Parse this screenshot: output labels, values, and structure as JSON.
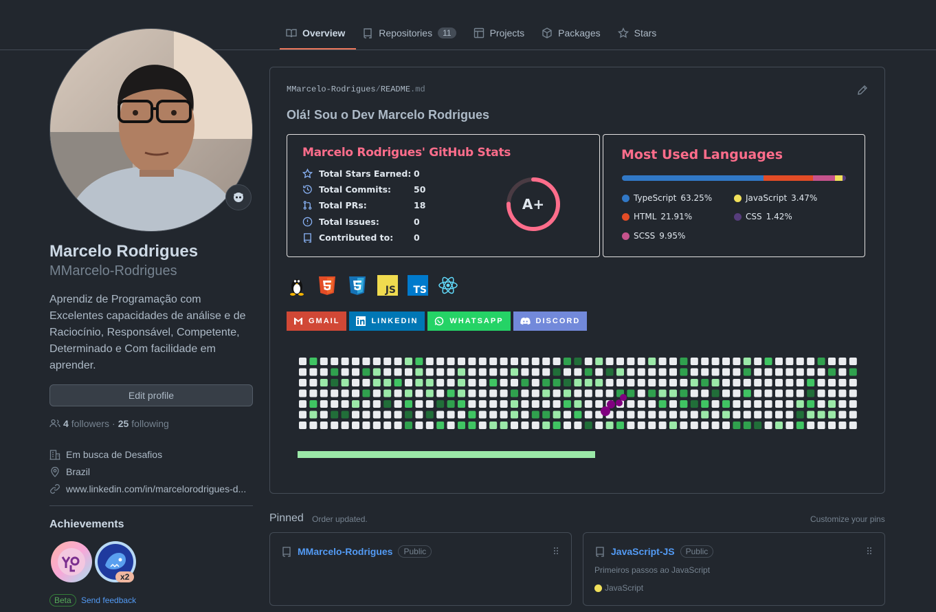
{
  "nav": {
    "tabs": [
      {
        "label": "Overview",
        "icon": "book-icon",
        "active": true
      },
      {
        "label": "Repositories",
        "icon": "repo-icon",
        "count": "11"
      },
      {
        "label": "Projects",
        "icon": "table-icon"
      },
      {
        "label": "Packages",
        "icon": "package-icon"
      },
      {
        "label": "Stars",
        "icon": "star-icon"
      }
    ]
  },
  "profile": {
    "name": "Marcelo Rodrigues",
    "login": "MMarcelo-Rodrigues",
    "bio": "Aprendiz de Programação com Excelentes capacidades de análise e de Raciocínio, Responsável, Competente, Determinado e Com facilidade em aprender.",
    "edit_label": "Edit profile",
    "followers": "4",
    "followers_label": "followers",
    "following": "25",
    "following_label": "following",
    "dot": "·",
    "company": "Em busca de Desafios",
    "location": "Brazil",
    "website": "www.linkedin.com/in/marcelorodrigues-d..."
  },
  "achievements": {
    "title": "Achievements",
    "badges": [
      {
        "name": "yolo"
      },
      {
        "name": "pull-shark",
        "multiplier": "x2"
      }
    ],
    "beta": "Beta",
    "feedback": "Send feedback"
  },
  "readme": {
    "owner": "MMarcelo-Rodrigues",
    "slash": "/",
    "file": "README",
    "ext": ".md",
    "heading": "Olá! Sou o Dev Marcelo Rodrigues"
  },
  "stats": {
    "title": "Marcelo Rodrigues' GitHub Stats",
    "rows": [
      {
        "label": "Total Stars Earned:",
        "value": "0",
        "icon": "star-icon"
      },
      {
        "label": "Total Commits:",
        "value": "50",
        "icon": "history-icon"
      },
      {
        "label": "Total PRs:",
        "value": "18",
        "icon": "pull-request-icon"
      },
      {
        "label": "Total Issues:",
        "value": "0",
        "icon": "issue-icon"
      },
      {
        "label": "Contributed to:",
        "value": "0",
        "icon": "repo-icon"
      }
    ],
    "grade": "A+"
  },
  "languages": {
    "title": "Most Used Languages",
    "items": [
      {
        "name": "TypeScript",
        "pct": "63.25%",
        "value": 63.25,
        "color": "#3178c6"
      },
      {
        "name": "JavaScript",
        "pct": "3.47%",
        "value": 3.47,
        "color": "#f1e05a"
      },
      {
        "name": "HTML",
        "pct": "21.91%",
        "value": 21.91,
        "color": "#e34c26"
      },
      {
        "name": "CSS",
        "pct": "1.42%",
        "value": 1.42,
        "color": "#563d7c"
      },
      {
        "name": "SCSS",
        "pct": "9.95%",
        "value": 9.95,
        "color": "#c6538c"
      }
    ]
  },
  "techs": [
    "linux-icon",
    "html5-icon",
    "css3-icon",
    "javascript-icon",
    "typescript-icon",
    "react-icon"
  ],
  "tech_labels": {
    "js": "JS",
    "ts": "TS"
  },
  "socials": [
    {
      "label": "GMAIL",
      "color": "#d14836",
      "icon": "gmail-icon"
    },
    {
      "label": "LINKEDIN",
      "color": "#0077b5",
      "icon": "linkedin-icon"
    },
    {
      "label": "WHATSAPP",
      "color": "#25d366",
      "icon": "whatsapp-icon"
    },
    {
      "label": "DISCORD",
      "color": "#7289da",
      "icon": "discord-icon"
    }
  ],
  "contrib_colors": [
    "#ebedf0",
    "#9be9a8",
    "#40c463",
    "#30a14e",
    "#216e39"
  ],
  "pinned": {
    "title": "Pinned",
    "subtitle": "Order updated.",
    "customize": "Customize your pins",
    "repos": [
      {
        "name": "MMarcelo-Rodrigues",
        "visibility": "Public",
        "description": "",
        "language": ""
      },
      {
        "name": "JavaScript-JS",
        "visibility": "Public",
        "description": "Primeiros passos ao JavaScript",
        "language": "JavaScript",
        "lang_color": "#f1e05a"
      }
    ]
  }
}
